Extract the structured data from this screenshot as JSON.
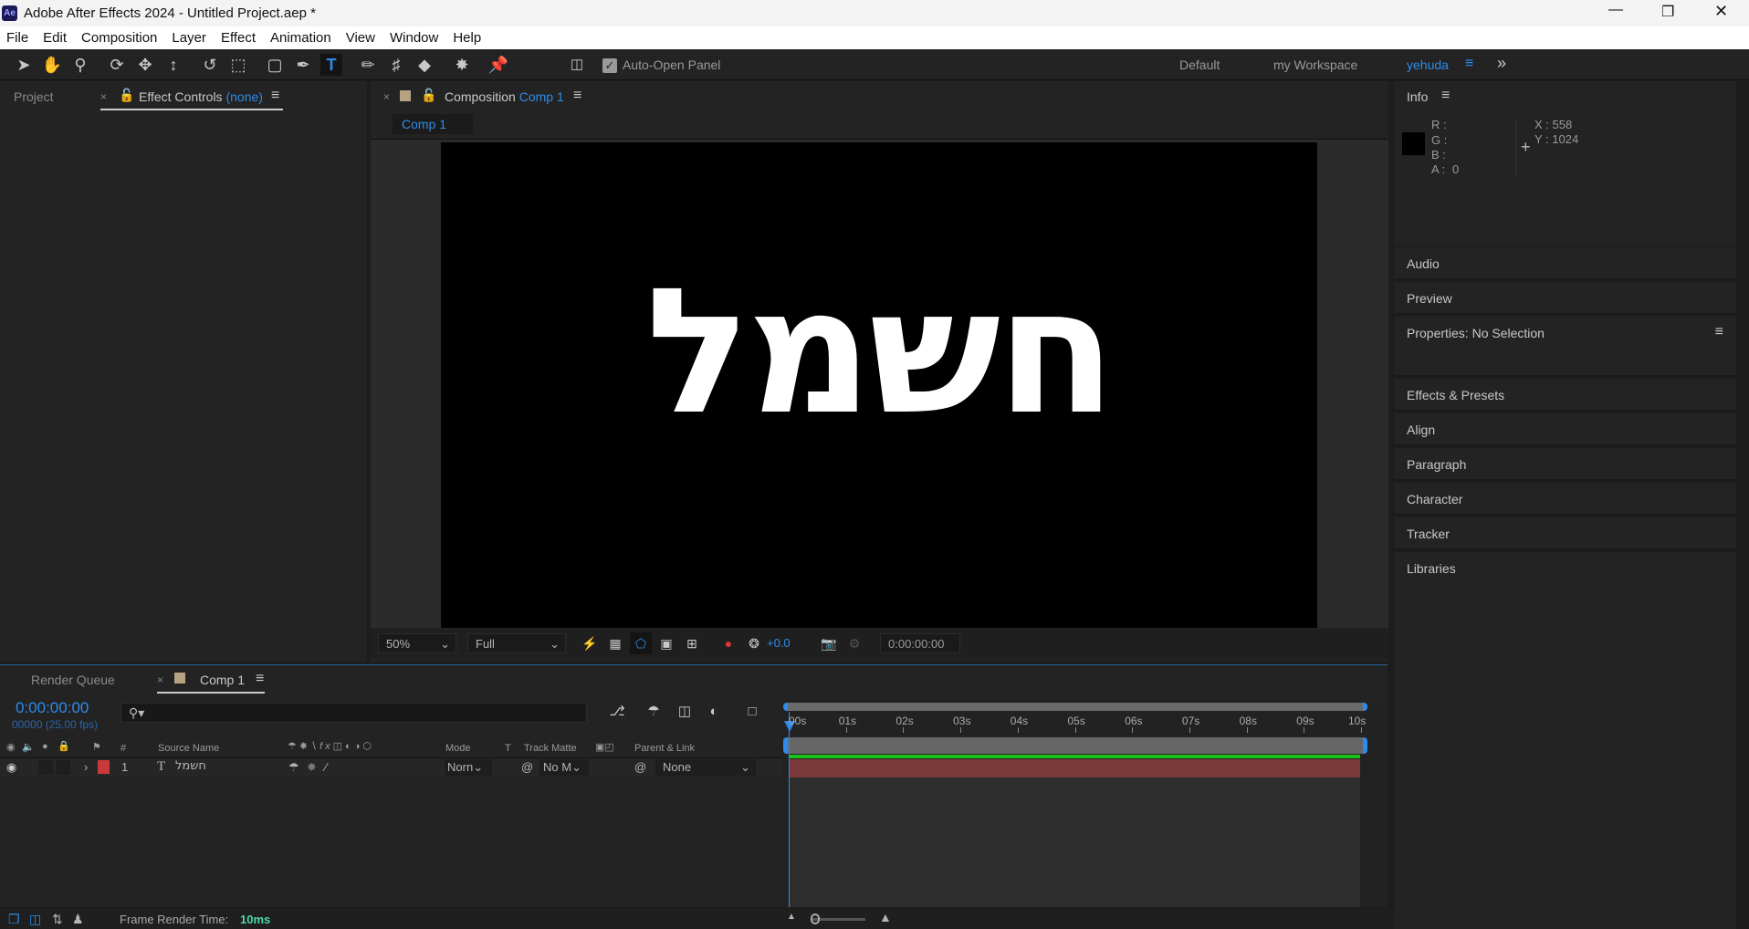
{
  "window": {
    "title": "Adobe After Effects 2024 - Untitled Project.aep *",
    "app_icon": "Ae",
    "controls": [
      "minimize",
      "restore",
      "close"
    ]
  },
  "menu": [
    "File",
    "Edit",
    "Composition",
    "Layer",
    "Effect",
    "Animation",
    "View",
    "Window",
    "Help"
  ],
  "toolbar": {
    "auto_open_label": "Auto-Open Panel",
    "auto_open_checked": true,
    "workspaces": [
      "Default",
      "my Workspace",
      "yehuda"
    ],
    "active_workspace": "yehuda"
  },
  "left_panel": {
    "tabs": [
      "Project",
      "Effect Controls"
    ],
    "effect_controls_target": "(none)"
  },
  "comp_panel": {
    "tab_prefix": "Composition",
    "tab_name": "Comp 1",
    "subtab": "Comp 1",
    "canvas_text": "חשמל",
    "zoom": "50%",
    "resolution": "Full",
    "exposure": "+0.0",
    "timecode": "0:00:00:00"
  },
  "info": {
    "title": "Info",
    "r": "R :",
    "g": "G :",
    "b": "B :",
    "a": "A :",
    "a_value": "0",
    "x": "X : 558",
    "y": "Y : 1024"
  },
  "right_panels": [
    "Audio",
    "Preview",
    "Properties: No Selection",
    "Effects & Presets",
    "Align",
    "Paragraph",
    "Character",
    "Tracker",
    "Libraries"
  ],
  "timeline": {
    "tabs": [
      "Render Queue",
      "Comp 1"
    ],
    "timecode": "0:00:00:00",
    "frames": "00000 (25.00 fps)",
    "columns": {
      "source_name": "Source Name",
      "num": "#",
      "mode": "Mode",
      "t": "T",
      "track_matte": "Track Matte",
      "parent": "Parent & Link"
    },
    "ruler": [
      "00s",
      "01s",
      "02s",
      "03s",
      "04s",
      "05s",
      "06s",
      "07s",
      "08s",
      "09s",
      "10s"
    ],
    "layers": [
      {
        "index": "1",
        "type": "T",
        "name": "חשמל",
        "label_color": "#c83a3a",
        "mode": "Norn",
        "matte": "No M",
        "parent": "None"
      }
    ]
  },
  "status": {
    "label": "Frame Render Time:",
    "value": "10ms"
  },
  "colors": {
    "accent": "#2d8ceb",
    "layer_bar": "#7a3a3a",
    "work_area": "#18c21a"
  }
}
